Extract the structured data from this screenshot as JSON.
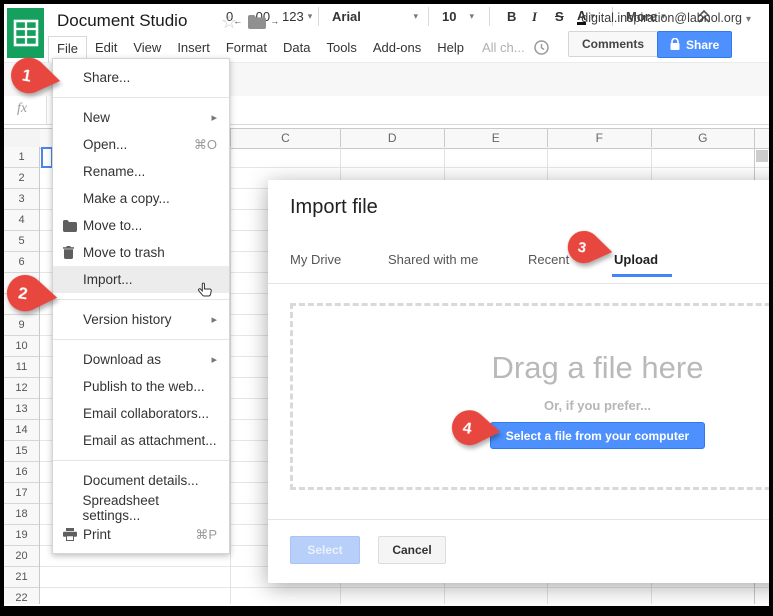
{
  "window": {
    "title": "Document Studio",
    "account_email": "digital.inspiration@labnol.org",
    "menubar": [
      "File",
      "Edit",
      "View",
      "Insert",
      "Format",
      "Data",
      "Tools",
      "Add-ons",
      "Help"
    ],
    "open_menu": "File",
    "all_changes_text": "All ch...",
    "comments_label": "Comments",
    "share_label": "Share"
  },
  "icons": {
    "star": "☆",
    "caret_down": "▾",
    "submenu_arrow": "▸",
    "arrow_left": "←",
    "arrow_right": "→"
  },
  "toolbar": {
    "decimal_decrease": "0",
    "decimal_increase": ".00",
    "number_format": "123",
    "font_family": "Arial",
    "font_size": "10",
    "bold": "B",
    "italic": "I",
    "strikethrough": "S",
    "text_color": "A",
    "more_label": "More"
  },
  "formula_bar": {
    "fx_label": "fx"
  },
  "grid": {
    "columns": [
      "C",
      "D",
      "E",
      "F",
      "G"
    ],
    "rows": [
      1,
      2,
      3,
      4,
      5,
      6,
      7,
      8,
      9,
      10,
      11,
      12,
      13,
      14,
      15,
      16,
      17,
      18,
      19,
      20,
      21,
      22
    ]
  },
  "file_menu": {
    "items": [
      {
        "label": "Share...",
        "type": "item"
      },
      {
        "type": "separator"
      },
      {
        "label": "New",
        "type": "item",
        "submenu": true
      },
      {
        "label": "Open...",
        "type": "item",
        "shortcut": "⌘O"
      },
      {
        "label": "Rename...",
        "type": "item"
      },
      {
        "label": "Make a copy...",
        "type": "item"
      },
      {
        "label": "Move to...",
        "type": "item",
        "icon": "folder-icon"
      },
      {
        "label": "Move to trash",
        "type": "item",
        "icon": "trash-icon"
      },
      {
        "label": "Import...",
        "type": "item",
        "highlight": true
      },
      {
        "type": "separator"
      },
      {
        "label": "Version history",
        "type": "item",
        "submenu": true
      },
      {
        "type": "separator"
      },
      {
        "label": "Download as",
        "type": "item",
        "submenu": true
      },
      {
        "label": "Publish to the web...",
        "type": "item"
      },
      {
        "label": "Email collaborators...",
        "type": "item"
      },
      {
        "label": "Email as attachment...",
        "type": "item"
      },
      {
        "type": "separator"
      },
      {
        "label": "Document details...",
        "type": "item"
      },
      {
        "label": "Spreadsheet settings...",
        "type": "item"
      },
      {
        "label": "Print",
        "type": "item",
        "icon": "printer-icon",
        "shortcut": "⌘P"
      }
    ]
  },
  "dialog": {
    "title": "Import file",
    "tabs": [
      {
        "label": "My Drive",
        "active": false
      },
      {
        "label": "Shared with me",
        "active": false
      },
      {
        "label": "Recent",
        "active": false
      },
      {
        "label": "Upload",
        "active": true
      }
    ],
    "dropzone": {
      "heading": "Drag a file here",
      "subtext": "Or, if you prefer...",
      "button_label": "Select a file from your computer"
    },
    "footer": {
      "select_label": "Select",
      "select_enabled": false,
      "cancel_label": "Cancel"
    }
  },
  "annotations": {
    "steps": [
      "1",
      "2",
      "3",
      "4"
    ]
  },
  "colors": {
    "accent_blue": "#4d90fe",
    "tab_underline": "#4285f4",
    "pin_red": "#e8473f",
    "sheets_green": "#16a05d"
  }
}
